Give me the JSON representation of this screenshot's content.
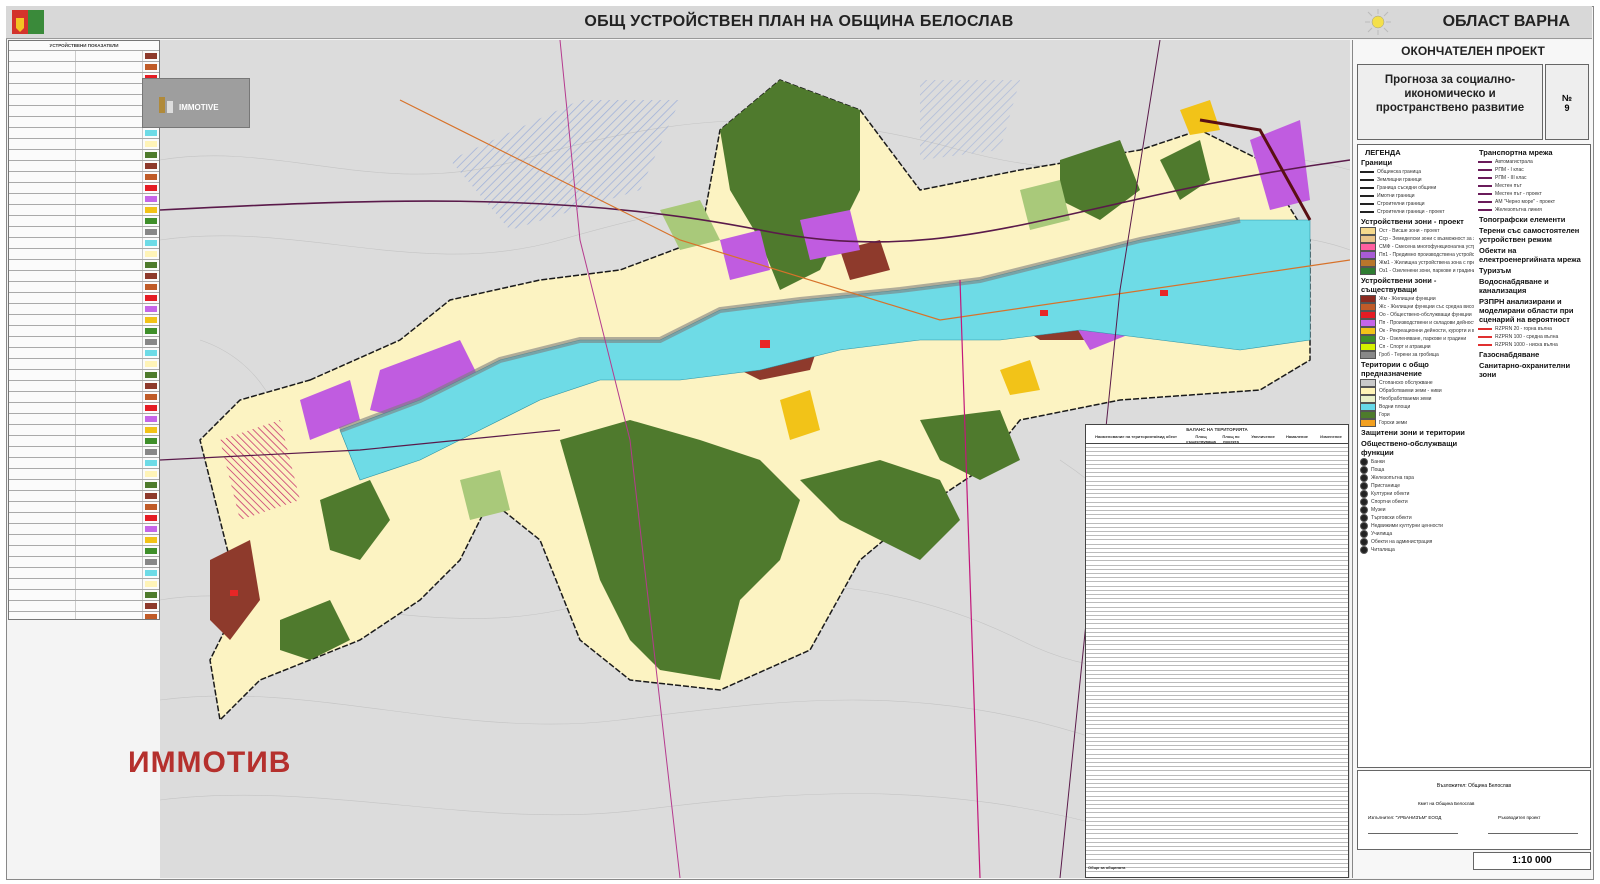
{
  "header": {
    "title": "ОБЩ УСТРОЙСТВЕН ПЛАН НА ОБЩИНА БЕЛОСЛАВ",
    "region": "ОБЛАСТ ВАРНА"
  },
  "watermark": "ИММОТИВ",
  "logo_badge": "IMMOTIVE",
  "right_panel": {
    "status": "ОКОНЧАТЕЛЕН ПРОЕКТ",
    "subtitle_lines": [
      "Прогноза за социално-",
      "икономическо и",
      "пространствено развитие"
    ],
    "sheet_no": "№",
    "sheet_value": "9",
    "scale": "1:10 000"
  },
  "legend": {
    "title": "ЛЕГЕНДА",
    "sections": {
      "borders": "Граници",
      "transport": "Транспортна мрежа",
      "zones_project": "Устройствени зони - проект",
      "zones_existing": "Устройствени зони - съществуващи",
      "topo": "Топографски елементи",
      "special": "Терени със самостоятелен устройствен режим",
      "agri": "Територии с общо предназначение",
      "protect": "Защитени зони и територии",
      "public": "Обществено-обслужващи функции",
      "power": "Обекти на електроенергийната мрежа",
      "tourism": "Туризъм",
      "water": "Водоснабдяване и канализация",
      "flood": "РЗПРН анализирани и моделирани области при сценарий на вероятност",
      "gas": "Газоснабдяване",
      "sanitary": "Санитарно-охранителни зони"
    },
    "border_items": [
      "Общинска граница",
      "Землищни граници",
      "Граница съседни общини",
      "Имотни граници",
      "Строителни граници",
      "Строителни граници - проект"
    ],
    "transport_items": [
      "Автомагистрала",
      "РПМ - I клас",
      "РПМ - III клас",
      "Местен път",
      "Местен път - проект",
      "АМ \"Черно море\" - проект",
      "Железопътна линия"
    ],
    "zone_project_items": [
      {
        "label": "Ост - Висше зони - проект",
        "color": "#f5d98c"
      },
      {
        "label": "Сср - Земеделски зони с възможност за застрояване",
        "color": "#e9c48a"
      },
      {
        "label": "СМФ - Смесена многофункционална устройствена зона - проект",
        "color": "#ff5fa0"
      },
      {
        "label": "Пп1 - Предимно производствена устройствена зона - проект",
        "color": "#a85bd6"
      },
      {
        "label": "Жм1 - Жилищна устройствена зона с преобладаващо ниско застрояване",
        "color": "#b8762c"
      },
      {
        "label": "Оз1 - Озеленени зони, паркове и градини - проект",
        "color": "#2f7d32"
      }
    ],
    "zone_existing_items": [
      {
        "label": "Жм - Жилищни функции",
        "color": "#8b2a20"
      },
      {
        "label": "Жс - Жилищни функции със средна височина",
        "color": "#c05b28"
      },
      {
        "label": "Оо - Обществено-обслужващи функции",
        "color": "#e41c24"
      },
      {
        "label": "Пп - Производствени и складови дейности",
        "color": "#c565e8"
      },
      {
        "label": "Ок - Рекреационни дейности, курорти и вилни зони",
        "color": "#f2c318"
      },
      {
        "label": "Оз - Озеленяване, паркове и градини",
        "color": "#3f8f2a"
      },
      {
        "label": "Сп - Спорт и атракции",
        "color": "#d6f000"
      },
      {
        "label": "Гроб - Терени за гробища",
        "color": "#888888"
      }
    ],
    "agri_items": [
      {
        "label": "Стопанско обслужване",
        "color": "#c9c9c9"
      },
      {
        "label": "Обработваеми земи - ниви",
        "color": "#fff4b8"
      },
      {
        "label": "Необработваеми земи",
        "color": "#e8f0c8"
      },
      {
        "label": "Водни площи",
        "color": "#66d9e8"
      },
      {
        "label": "Гори",
        "color": "#4e7b2c"
      },
      {
        "label": "Горски земи",
        "color": "#f2a020"
      }
    ],
    "public_items": [
      "Банки",
      "Поща",
      "Железопътна гара",
      "Пристанище",
      "Културни обекти",
      "Спортни обекти",
      "Музеи",
      "Търговски обекти",
      "Недвижими културни ценности",
      "Училища",
      "Обекти на администрация",
      "Читалища"
    ],
    "flood_items": [
      "RZPRN 20 - горна вълна",
      "RZPRN 100 - средна вълна",
      "RZPRN 1000 - ниска вълна"
    ]
  },
  "table": {
    "title": "БАЛАНС НА ТЕРИТОРИЯТА",
    "columns": [
      "Наименование на територията/вид обект",
      "Площ съществуваща",
      "Площ по проекта",
      "Увеличение",
      "Намаление",
      "Изменение"
    ],
    "totals": [
      "Общо площ",
      "Общо за общината"
    ]
  },
  "signatures": {
    "title": "Възложител: Община Белослав",
    "lines": [
      "Кмет на Община Белослав",
      "Изпълнител: \"УРБАНИЗЪМ\" ЕООД",
      "Ръководител проект"
    ]
  },
  "colors": {
    "water": "#6edbe6",
    "forest": "#4f7a2d",
    "fields": "#fdf5c0",
    "residential": "#8e3a2c",
    "industrial": "#c05ce0",
    "public": "#e82626",
    "border": "#5a0f14"
  }
}
